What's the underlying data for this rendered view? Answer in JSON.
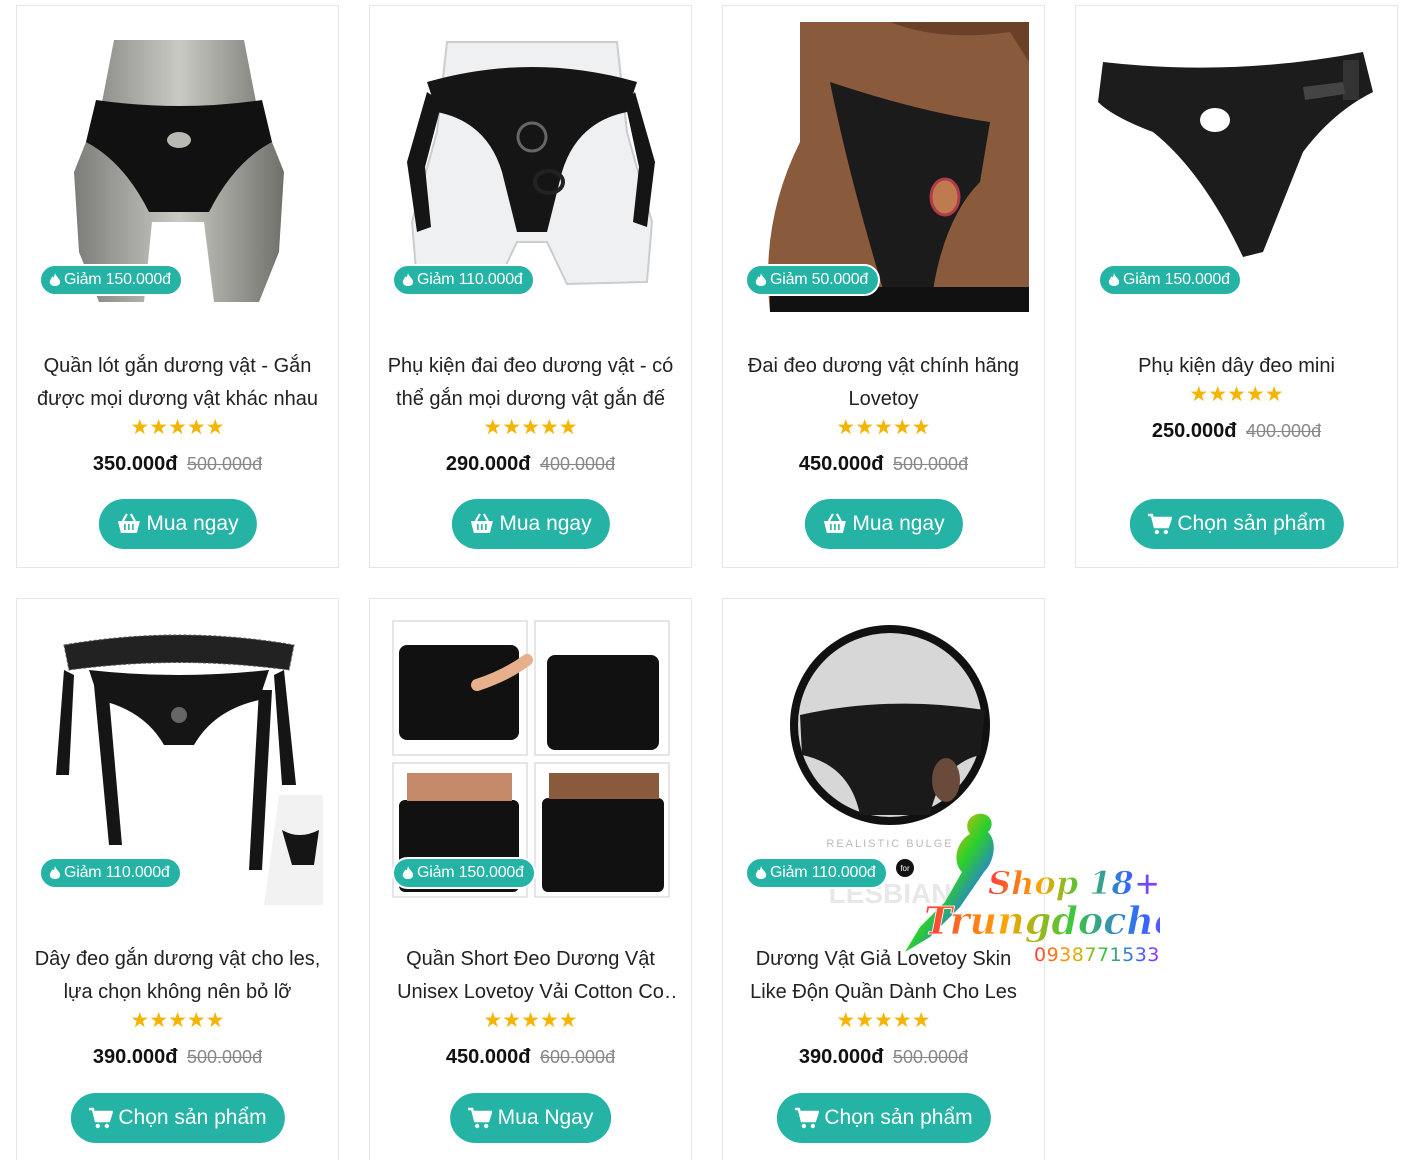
{
  "products": [
    {
      "badge": "Giảm 150.000đ",
      "title": "Quần lót gắn dương vật - Gắn được mọi dương vật khác nhau",
      "stars": "★★★★★",
      "price": "350.000đ",
      "old_price": "500.000đ",
      "button": "Mua ngay",
      "button_icon": "basket-icon"
    },
    {
      "badge": "Giảm 110.000đ",
      "title": "Phụ kiện đai đeo dương vật - có thể gắn mọi dương vật gắn đế",
      "stars": "★★★★★",
      "price": "290.000đ",
      "old_price": "400.000đ",
      "button": "Mua ngay",
      "button_icon": "basket-icon"
    },
    {
      "badge": "Giảm 50.000đ",
      "title": "Đai đeo dương vật chính hãng Lovetoy",
      "stars": "★★★★★",
      "price": "450.000đ",
      "old_price": "500.000đ",
      "button": "Mua ngay",
      "button_icon": "basket-icon"
    },
    {
      "badge": "Giảm 150.000đ",
      "title": "Phụ kiện dây đeo mini",
      "stars": "★★★★★",
      "price": "250.000đ",
      "old_price": "400.000đ",
      "button": "Chọn sản phẩm",
      "button_icon": "cart-icon"
    },
    {
      "badge": "Giảm 110.000đ",
      "title": "Dây đeo gắn dương vật cho les, lựa chọn không nên bỏ lỡ",
      "stars": "★★★★★",
      "price": "390.000đ",
      "old_price": "500.000đ",
      "button": "Chọn sản phẩm",
      "button_icon": "cart-icon"
    },
    {
      "badge": "Giảm 150.000đ",
      "title": "Quần Short Đeo Dương Vật Unisex Lovetoy Vải Cotton Co Giãn",
      "stars": "★★★★★",
      "price": "450.000đ",
      "old_price": "600.000đ",
      "button": "Mua Ngay",
      "button_icon": "cart-icon"
    },
    {
      "badge": "Giảm 110.000đ",
      "title": "Dương Vật Giả Lovetoy Skin Like Độn Quần Dành Cho Les",
      "stars": "★★★★★",
      "price": "390.000đ",
      "old_price": "500.000đ",
      "button": "Chọn sản phẩm",
      "button_icon": "cart-icon"
    }
  ],
  "image_texts": {
    "bulge_caption": "REALISTIC BULGE",
    "bulge_for": "for",
    "bulge_brand": "LESBIAN"
  },
  "watermark": {
    "line1": "Shop 18+",
    "line2": "Trungdochoi",
    "phone": "0938771533"
  },
  "colors": {
    "accent": "#25b3a6",
    "star": "#f5b400",
    "old_price": "#888888"
  }
}
